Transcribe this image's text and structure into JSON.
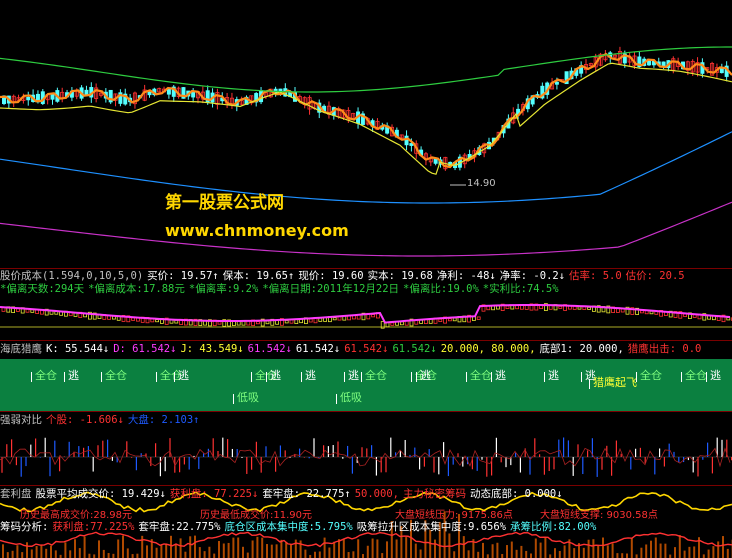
{
  "chart_data": [
    {
      "type": "candlestick",
      "panel": "main",
      "price_annotation": "14.90",
      "series": [
        {
          "kind": "candles",
          "up_color": "#ff3232",
          "down_color": "#54ffff"
        },
        {
          "kind": "line",
          "color": "#ff8c1a"
        },
        {
          "kind": "line",
          "color": "#e6e633"
        },
        {
          "kind": "line",
          "color": "#2ecc40"
        },
        {
          "kind": "line",
          "color": "#1e90ff"
        },
        {
          "kind": "line",
          "color": "#c832c8"
        }
      ]
    },
    {
      "type": "line",
      "panel": "cost",
      "header": [
        {
          "text": "股价成本(1.594,0,10,5,0)",
          "color": "#c0c0c0"
        },
        {
          "text": "买价: 19.57↑",
          "color": "#ffffff"
        },
        {
          "text": "保本: 19.65↑",
          "color": "#ffffff"
        },
        {
          "text": "现价: 19.60",
          "color": "#ffffff"
        },
        {
          "text": "实本: 19.68",
          "color": "#ffffff"
        },
        {
          "text": "净利: -48↓",
          "color": "#ffffff"
        },
        {
          "text": "净率: -0.2↓",
          "color": "#ffffff"
        },
        {
          "text": "估率: 5.0",
          "color": "#ff3232"
        },
        {
          "text": "估价: 20.5",
          "color": "#ff3232"
        }
      ],
      "header2": [
        {
          "text": "*偏离天数:294天",
          "color": "#2ecc40"
        },
        {
          "text": "*偏离成本:17.88元",
          "color": "#2ecc40"
        },
        {
          "text": "*偏离率:9.2%",
          "color": "#2ecc40"
        },
        {
          "text": "*偏离日期:2011年12月22日",
          "color": "#2ecc40"
        },
        {
          "text": "*偏离比:19.0%",
          "color": "#2ecc40"
        },
        {
          "text": "*实利比:74.5%",
          "color": "#2ecc40"
        }
      ]
    },
    {
      "type": "signals",
      "panel": "hunter",
      "header": [
        {
          "text": "海底猎鹰",
          "color": "#c0c0c0"
        },
        {
          "text": "K: 55.544↓",
          "color": "#ffffff"
        },
        {
          "text": "D: 61.542↓",
          "color": "#ff3cff"
        },
        {
          "text": "J: 43.549↓",
          "color": "#ffff33"
        },
        {
          "text": "61.542↓",
          "color": "#ff3cff"
        },
        {
          "text": "61.542↓",
          "color": "#ffffff"
        },
        {
          "text": "61.542↓",
          "color": "#ff3232"
        },
        {
          "text": "61.542↓",
          "color": "#2ecc40"
        },
        {
          "text": "20.000, 80.000,",
          "color": "#ffff33"
        },
        {
          "text": "底部1: 20.000,",
          "color": "#ffffff"
        },
        {
          "text": "猎鹰出击: 0.0",
          "color": "#ff3232"
        }
      ],
      "labels": {
        "full": "全仓",
        "escape": "逃",
        "low": "低吸",
        "surge": "猎鹰起飞"
      },
      "full_positions": [
        25,
        95,
        150,
        245,
        355,
        405,
        460,
        630,
        675
      ],
      "escape_positions": [
        68,
        178,
        270,
        305,
        348,
        420,
        495,
        548,
        585,
        710
      ],
      "low_positions": [
        237,
        340
      ],
      "surge_position": 593,
      "bg_color": "#0b8040"
    },
    {
      "type": "bar",
      "panel": "strength",
      "header": [
        {
          "text": "强弱对比",
          "color": "#c0c0c0"
        },
        {
          "text": "个股: -1.606↓",
          "color": "#ff3232"
        },
        {
          "text": "大盘: 2.103↑",
          "color": "#1e5aff"
        }
      ]
    },
    {
      "type": "area",
      "panel": "chips",
      "header": [
        {
          "text": "套利盘",
          "color": "#c0c0c0"
        },
        {
          "text": "股票平均成交价: 19.429↓",
          "color": "#ffffff"
        },
        {
          "text": "获利盘: 77.225↓",
          "color": "#ff3232"
        },
        {
          "text": "套牢盘: 22.775↑",
          "color": "#ffffff"
        },
        {
          "text": "50.000,",
          "color": "#ff3232"
        },
        {
          "text": "主力秘密筹码",
          "color": "#ff3232"
        },
        {
          "text": "动态底部: 0.000↓",
          "color": "#ffffff"
        }
      ],
      "notes": [
        {
          "text": "历史最高成交价:28.98元",
          "color": "#ff3232"
        },
        {
          "text": "历史最低成交价:11.90元",
          "color": "#ff3232"
        },
        {
          "text": "大盘短线压力: 9175.86点",
          "color": "#ff3232"
        },
        {
          "text": "大盘短线支撑: 9030.58点",
          "color": "#ff3232"
        }
      ],
      "footer": [
        {
          "text": "筹码分析:",
          "color": "#ffffff"
        },
        {
          "text": "获利盘:77.225%",
          "color": "#ff3232"
        },
        {
          "text": "套牢盘:22.775%",
          "color": "#ffffff"
        },
        {
          "text": "底仓区成本集中度:5.795%",
          "color": "#54ffff"
        },
        {
          "text": "吸筹拉升区成本集中度:9.656%",
          "color": "#ffffff"
        },
        {
          "text": "承筹比例:82.00%",
          "color": "#54ffff"
        }
      ]
    }
  ],
  "watermark": {
    "title": "第一股票公式网",
    "url": "www.chnmoney.com",
    "title_color": "#ffd700",
    "url_color": "#ffd700"
  }
}
